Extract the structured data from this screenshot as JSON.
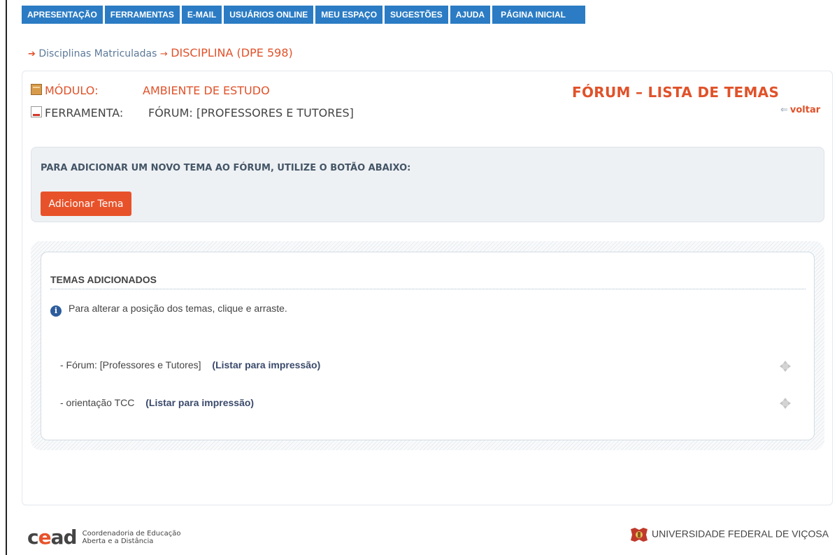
{
  "nav": {
    "items": [
      "APRESENTAÇÃO",
      "FERRAMENTAS",
      "E-MAIL",
      "USUÁRIOS ONLINE",
      "MEU ESPAÇO",
      "SUGESTÕES",
      "AJUDA",
      "PÁGINA INICIAL"
    ]
  },
  "breadcrumb": {
    "link": "Disciplinas Matriculadas",
    "current": "DISCIPLINA (DPE 598)"
  },
  "module": {
    "label": "MÓDULO:",
    "value": "AMBIENTE DE ESTUDO"
  },
  "tool": {
    "label": "FERRAMENTA:",
    "value": "FÓRUM: [PROFESSORES E TUTORES]"
  },
  "page_title": "FÓRUM – LISTA DE TEMAS",
  "back_link": "voltar",
  "add_section": {
    "instruction": "PARA ADICIONAR UM NOVO TEMA AO FÓRUM, UTILIZE O BOTÃO ABAIXO:",
    "button_label": "Adicionar Tema"
  },
  "topics_section": {
    "heading": "TEMAS ADICIONADOS",
    "info": "Para alterar a posição dos temas, clique e arraste.",
    "topics": [
      {
        "name": "- Fórum: [Professores e Tutores]",
        "print_link": "(Listar para impressão)"
      },
      {
        "name": "- orientação TCC",
        "print_link": "(Listar para impressão)"
      }
    ]
  },
  "footer": {
    "logo": "cead",
    "logo_line1": "Coordenadoria de Educação",
    "logo_line2": "Aberta e a Distância",
    "university": "UNIVERSIDADE FEDERAL DE VIÇOSA"
  },
  "colors": {
    "nav_blue": "#2b7cc4",
    "accent_orange": "#e0522a",
    "button_orange": "#e8522a"
  },
  "icons": [
    "box-icon",
    "file-icon",
    "info-icon",
    "drag-handle-icon",
    "arrow-right-icon",
    "arrow-left-icon"
  ]
}
